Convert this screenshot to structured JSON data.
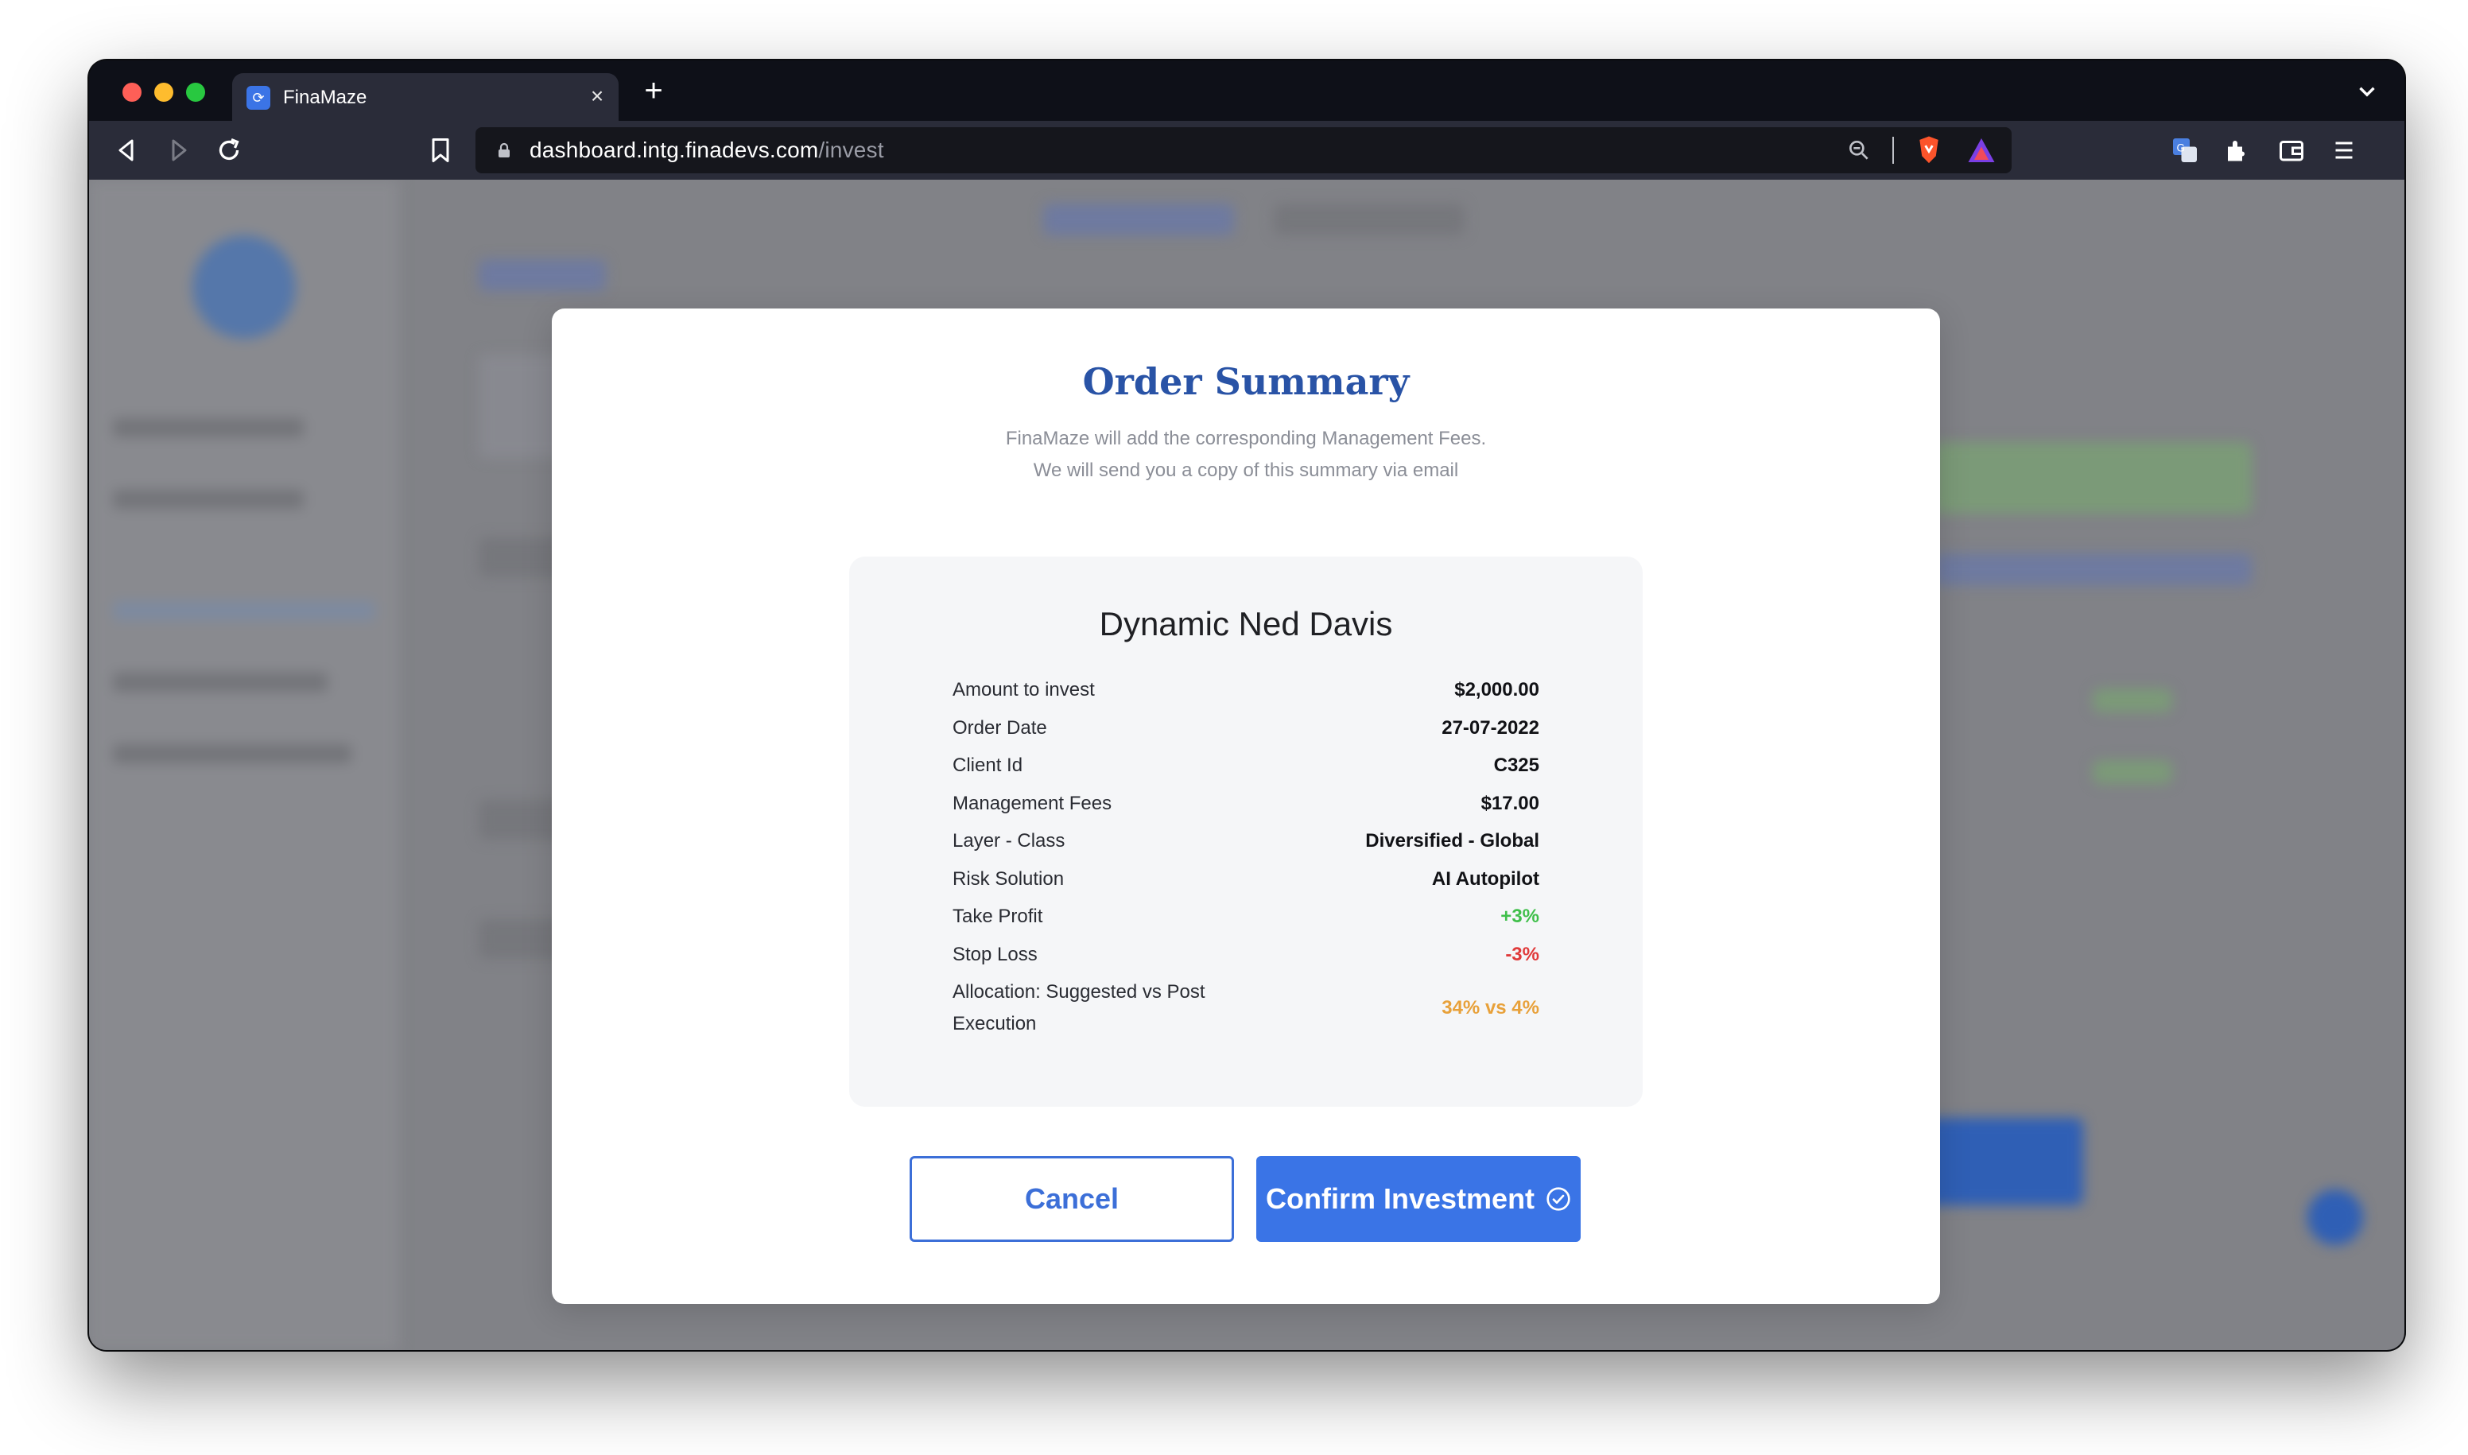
{
  "browser": {
    "tab_title": "FinaMaze",
    "tab_close": "×",
    "new_tab": "+",
    "url_domain": "dashboard.intg.finadevs.com",
    "url_path": "/invest"
  },
  "modal": {
    "title": "Order Summary",
    "subtitle_line1": "FinaMaze will add the corresponding Management Fees.",
    "subtitle_line2": "We will send you a copy of this summary via email",
    "product_name": "Dynamic Ned Davis",
    "rows": [
      {
        "label": "Amount to invest",
        "value": "$2,000.00",
        "color": "#111216"
      },
      {
        "label": "Order Date",
        "value": "27-07-2022",
        "color": "#111216"
      },
      {
        "label": "Client Id",
        "value": "C325",
        "color": "#111216"
      },
      {
        "label": "Management Fees",
        "value": "$17.00",
        "color": "#111216"
      },
      {
        "label": "Layer - Class",
        "value": "Diversified - Global",
        "color": "#111216"
      },
      {
        "label": "Risk Solution",
        "value": "AI Autopilot",
        "color": "#111216"
      },
      {
        "label": "Take Profit",
        "value": "+3%",
        "color": "#3fbf4a"
      },
      {
        "label": "Stop Loss",
        "value": "-3%",
        "color": "#e03a3a"
      },
      {
        "label": "Allocation: Suggested vs Post Execution",
        "value": "34% vs 4%",
        "color": "#e8a13a"
      }
    ],
    "cancel_label": "Cancel",
    "confirm_label": "Confirm Investment"
  },
  "colors": {
    "accent": "#3a74e6",
    "title": "#2953a6"
  }
}
